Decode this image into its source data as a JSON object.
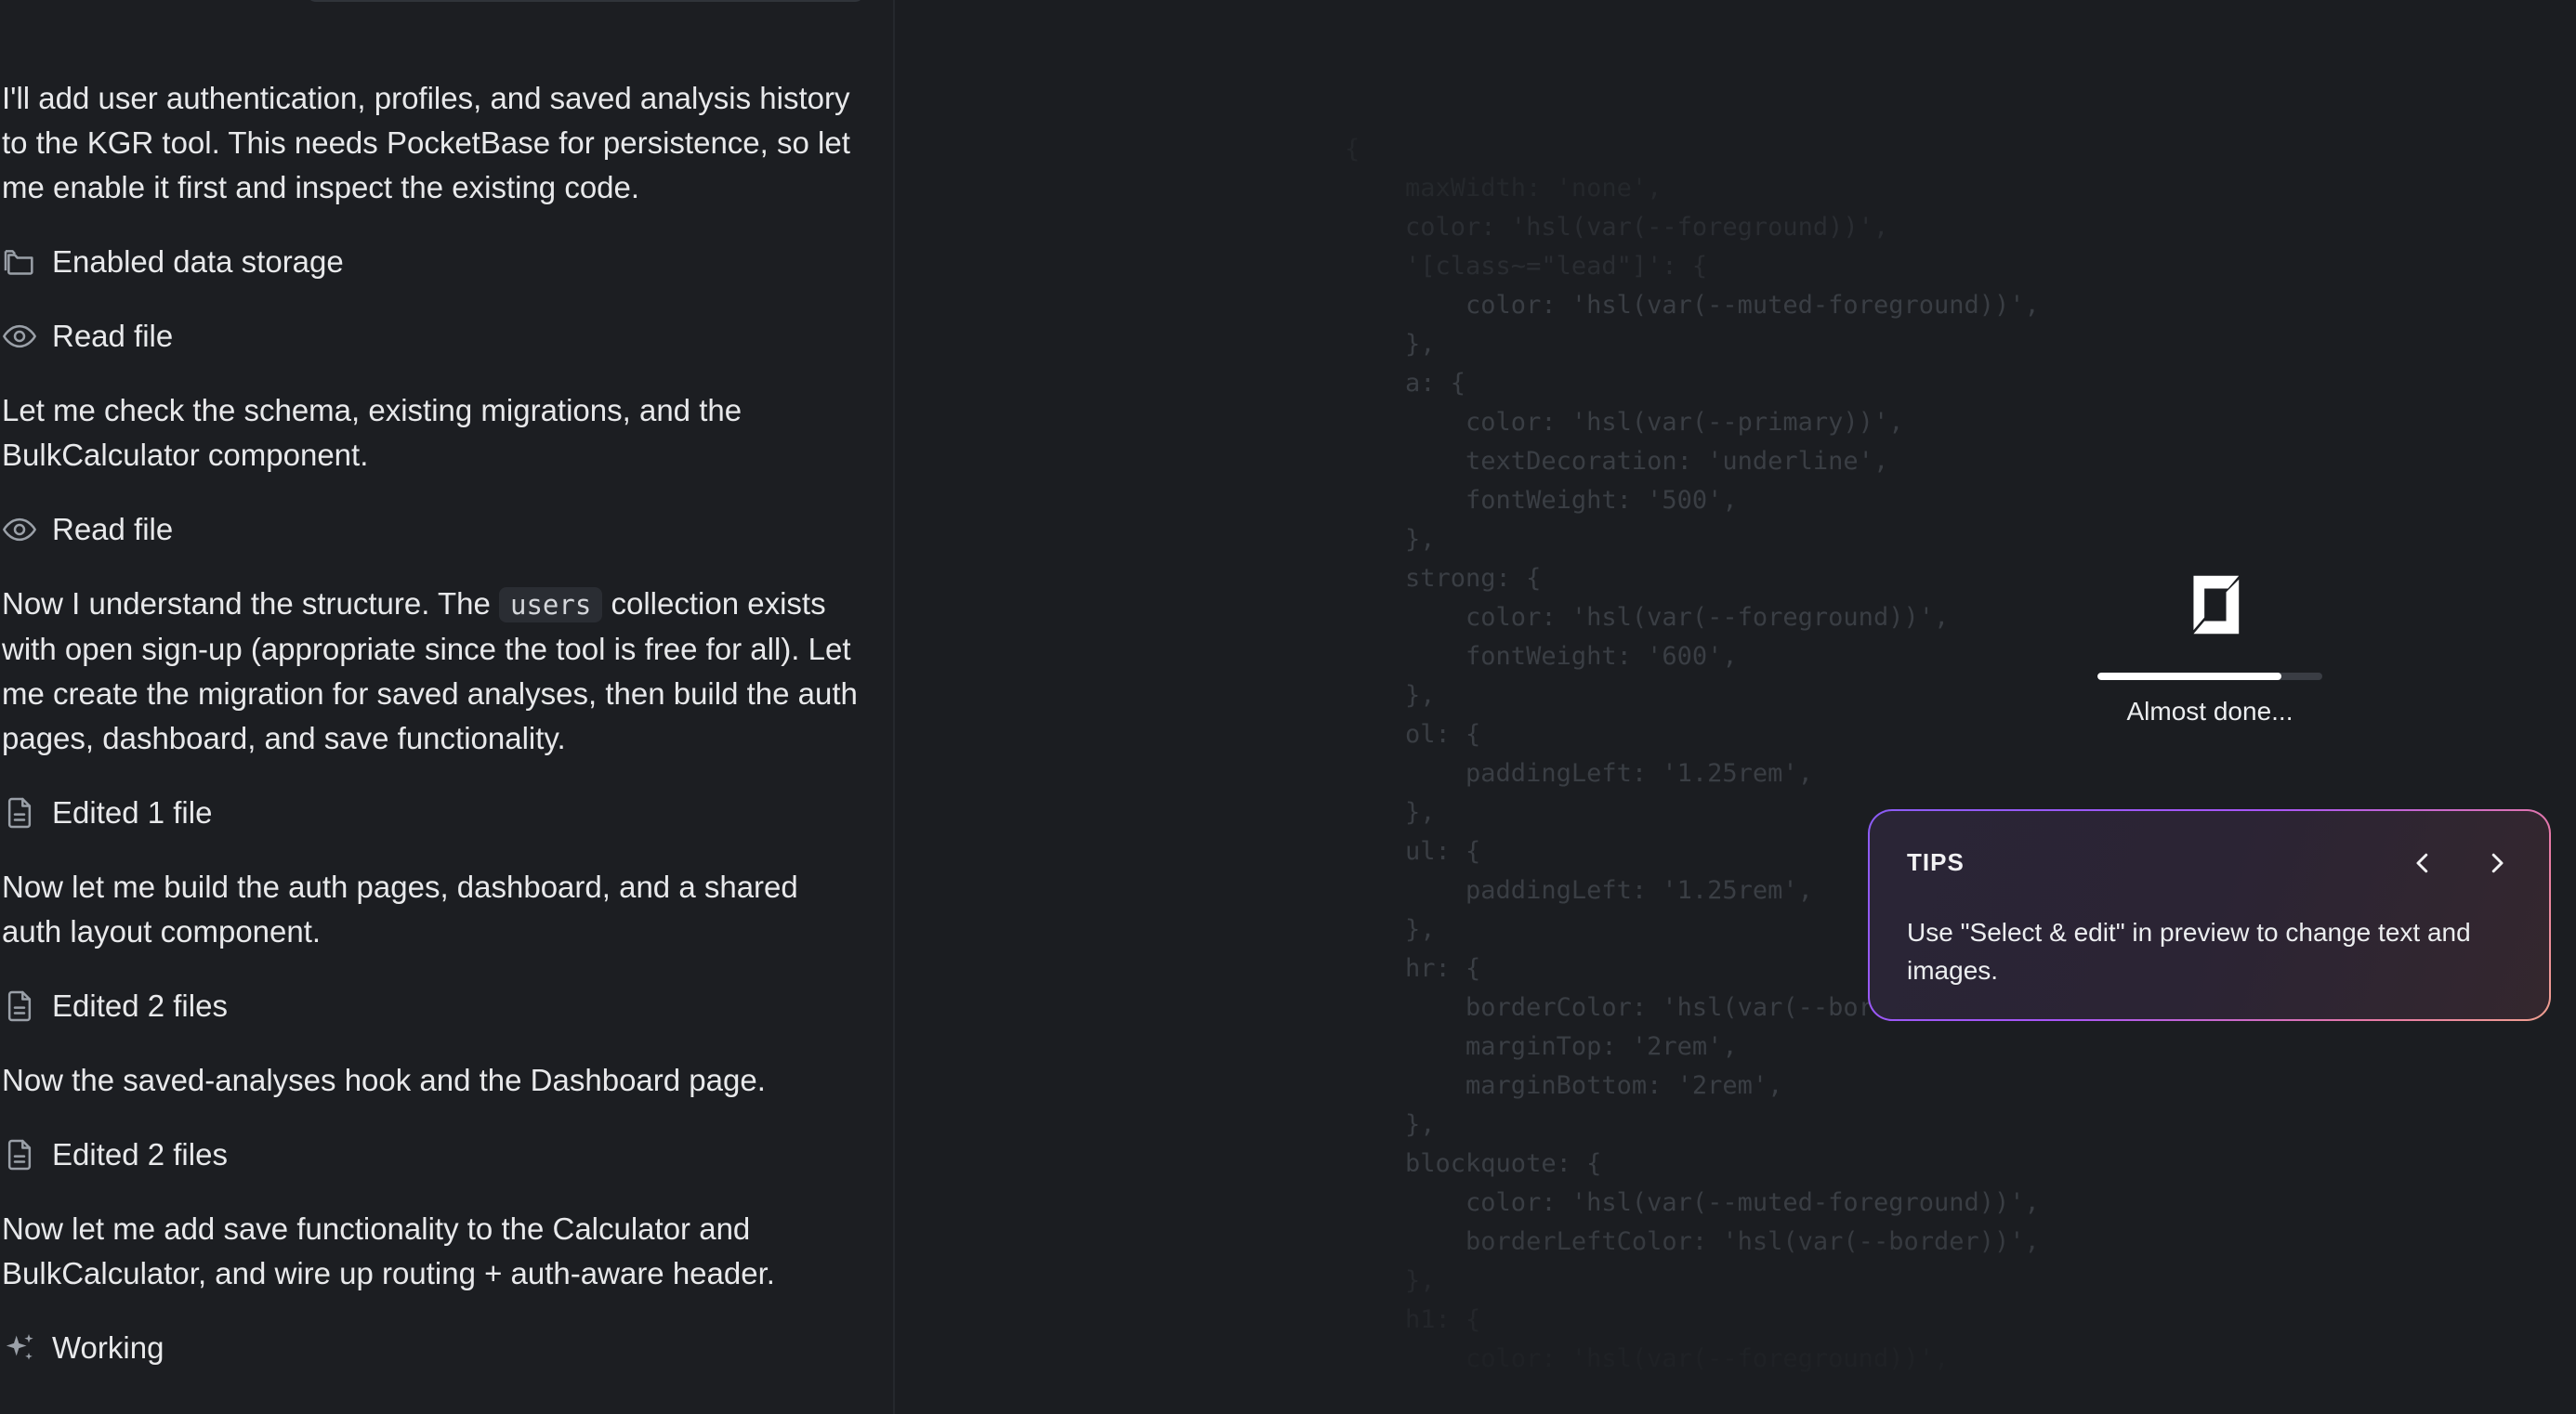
{
  "chat": {
    "messages": [
      {
        "type": "text",
        "text": "I'll add user authentication, profiles, and saved analysis history to the KGR tool. This needs PocketBase for persistence, so let me enable it first and inspect the existing code."
      },
      {
        "type": "action",
        "icon": "folder-icon",
        "label": "Enabled data storage"
      },
      {
        "type": "action",
        "icon": "eye-icon",
        "label": "Read file"
      },
      {
        "type": "text",
        "text": "Let me check the schema, existing migrations, and the BulkCalculator component."
      },
      {
        "type": "action",
        "icon": "eye-icon",
        "label": "Read file"
      },
      {
        "type": "rich",
        "before": "Now I understand the structure. The ",
        "code": "users",
        "after": " collection exists with open sign-up (appropriate since the tool is free for all). Let me create the migration for saved analyses, then build the auth pages, dashboard, and save functionality."
      },
      {
        "type": "action",
        "icon": "file-icon",
        "label": "Edited 1 file"
      },
      {
        "type": "text",
        "text": "Now let me build the auth pages, dashboard, and a shared auth layout component."
      },
      {
        "type": "action",
        "icon": "file-icon",
        "label": "Edited 2 files"
      },
      {
        "type": "text",
        "text": "Now the saved-analyses hook and the Dashboard page."
      },
      {
        "type": "action",
        "icon": "file-icon",
        "label": "Edited 2 files"
      },
      {
        "type": "text",
        "text": "Now let me add save functionality to the Calculator and BulkCalculator, and wire up routing + auth-aware header."
      },
      {
        "type": "action",
        "icon": "sparkle-icon",
        "label": "Working"
      }
    ]
  },
  "preview": {
    "code_lines": [
      {
        "text": "{",
        "tone": "fainter"
      },
      {
        "text": "    maxWidth: 'none',",
        "tone": "fainter"
      },
      {
        "text": "    color: 'hsl(var(--foreground))',",
        "tone": "faint"
      },
      {
        "text": "    '[class~=\"lead\"]': {",
        "tone": "faint"
      },
      {
        "text": "        color: 'hsl(var(--muted-foreground))',",
        "tone": ""
      },
      {
        "text": "    },",
        "tone": ""
      },
      {
        "text": "    a: {",
        "tone": ""
      },
      {
        "text": "        color: 'hsl(var(--primary))',",
        "tone": ""
      },
      {
        "text": "        textDecoration: 'underline',",
        "tone": ""
      },
      {
        "text": "        fontWeight: '500',",
        "tone": ""
      },
      {
        "text": "    },",
        "tone": ""
      },
      {
        "text": "    strong: {",
        "tone": ""
      },
      {
        "text": "        color: 'hsl(var(--foreground))',",
        "tone": ""
      },
      {
        "text": "        fontWeight: '600',",
        "tone": ""
      },
      {
        "text": "    },",
        "tone": ""
      },
      {
        "text": "    ol: {",
        "tone": ""
      },
      {
        "text": "        paddingLeft: '1.25rem',",
        "tone": ""
      },
      {
        "text": "    },",
        "tone": ""
      },
      {
        "text": "    ul: {",
        "tone": ""
      },
      {
        "text": "        paddingLeft: '1.25rem',",
        "tone": ""
      },
      {
        "text": "    },",
        "tone": ""
      },
      {
        "text": "    hr: {",
        "tone": ""
      },
      {
        "text": "        borderColor: 'hsl(var(--border))',",
        "tone": ""
      },
      {
        "text": "        marginTop: '2rem',",
        "tone": ""
      },
      {
        "text": "        marginBottom: '2rem',",
        "tone": ""
      },
      {
        "text": "    },",
        "tone": ""
      },
      {
        "text": "    blockquote: {",
        "tone": ""
      },
      {
        "text": "        color: 'hsl(var(--muted-foreground))',",
        "tone": ""
      },
      {
        "text": "        borderLeftColor: 'hsl(var(--border))',",
        "tone": ""
      },
      {
        "text": "    },",
        "tone": "faint"
      },
      {
        "text": "    h1: {",
        "tone": "faint"
      },
      {
        "text": "        color: 'hsl(var(--foreground))',",
        "tone": "fainter"
      }
    ],
    "loader": {
      "status_text": "Almost done...",
      "progress": 0.82
    },
    "tips": {
      "title": "TIPS",
      "body": "Use \"Select & edit\" in preview to change text and images.",
      "prev_icon": "chevron-left-icon",
      "next_icon": "chevron-right-icon"
    }
  },
  "colors": {
    "background": "#1b1d21",
    "text": "#e8e9eb",
    "muted_icon": "#9aa0a8",
    "tips_border_start": "#8b5cf6",
    "tips_border_end": "#f0a08f"
  }
}
